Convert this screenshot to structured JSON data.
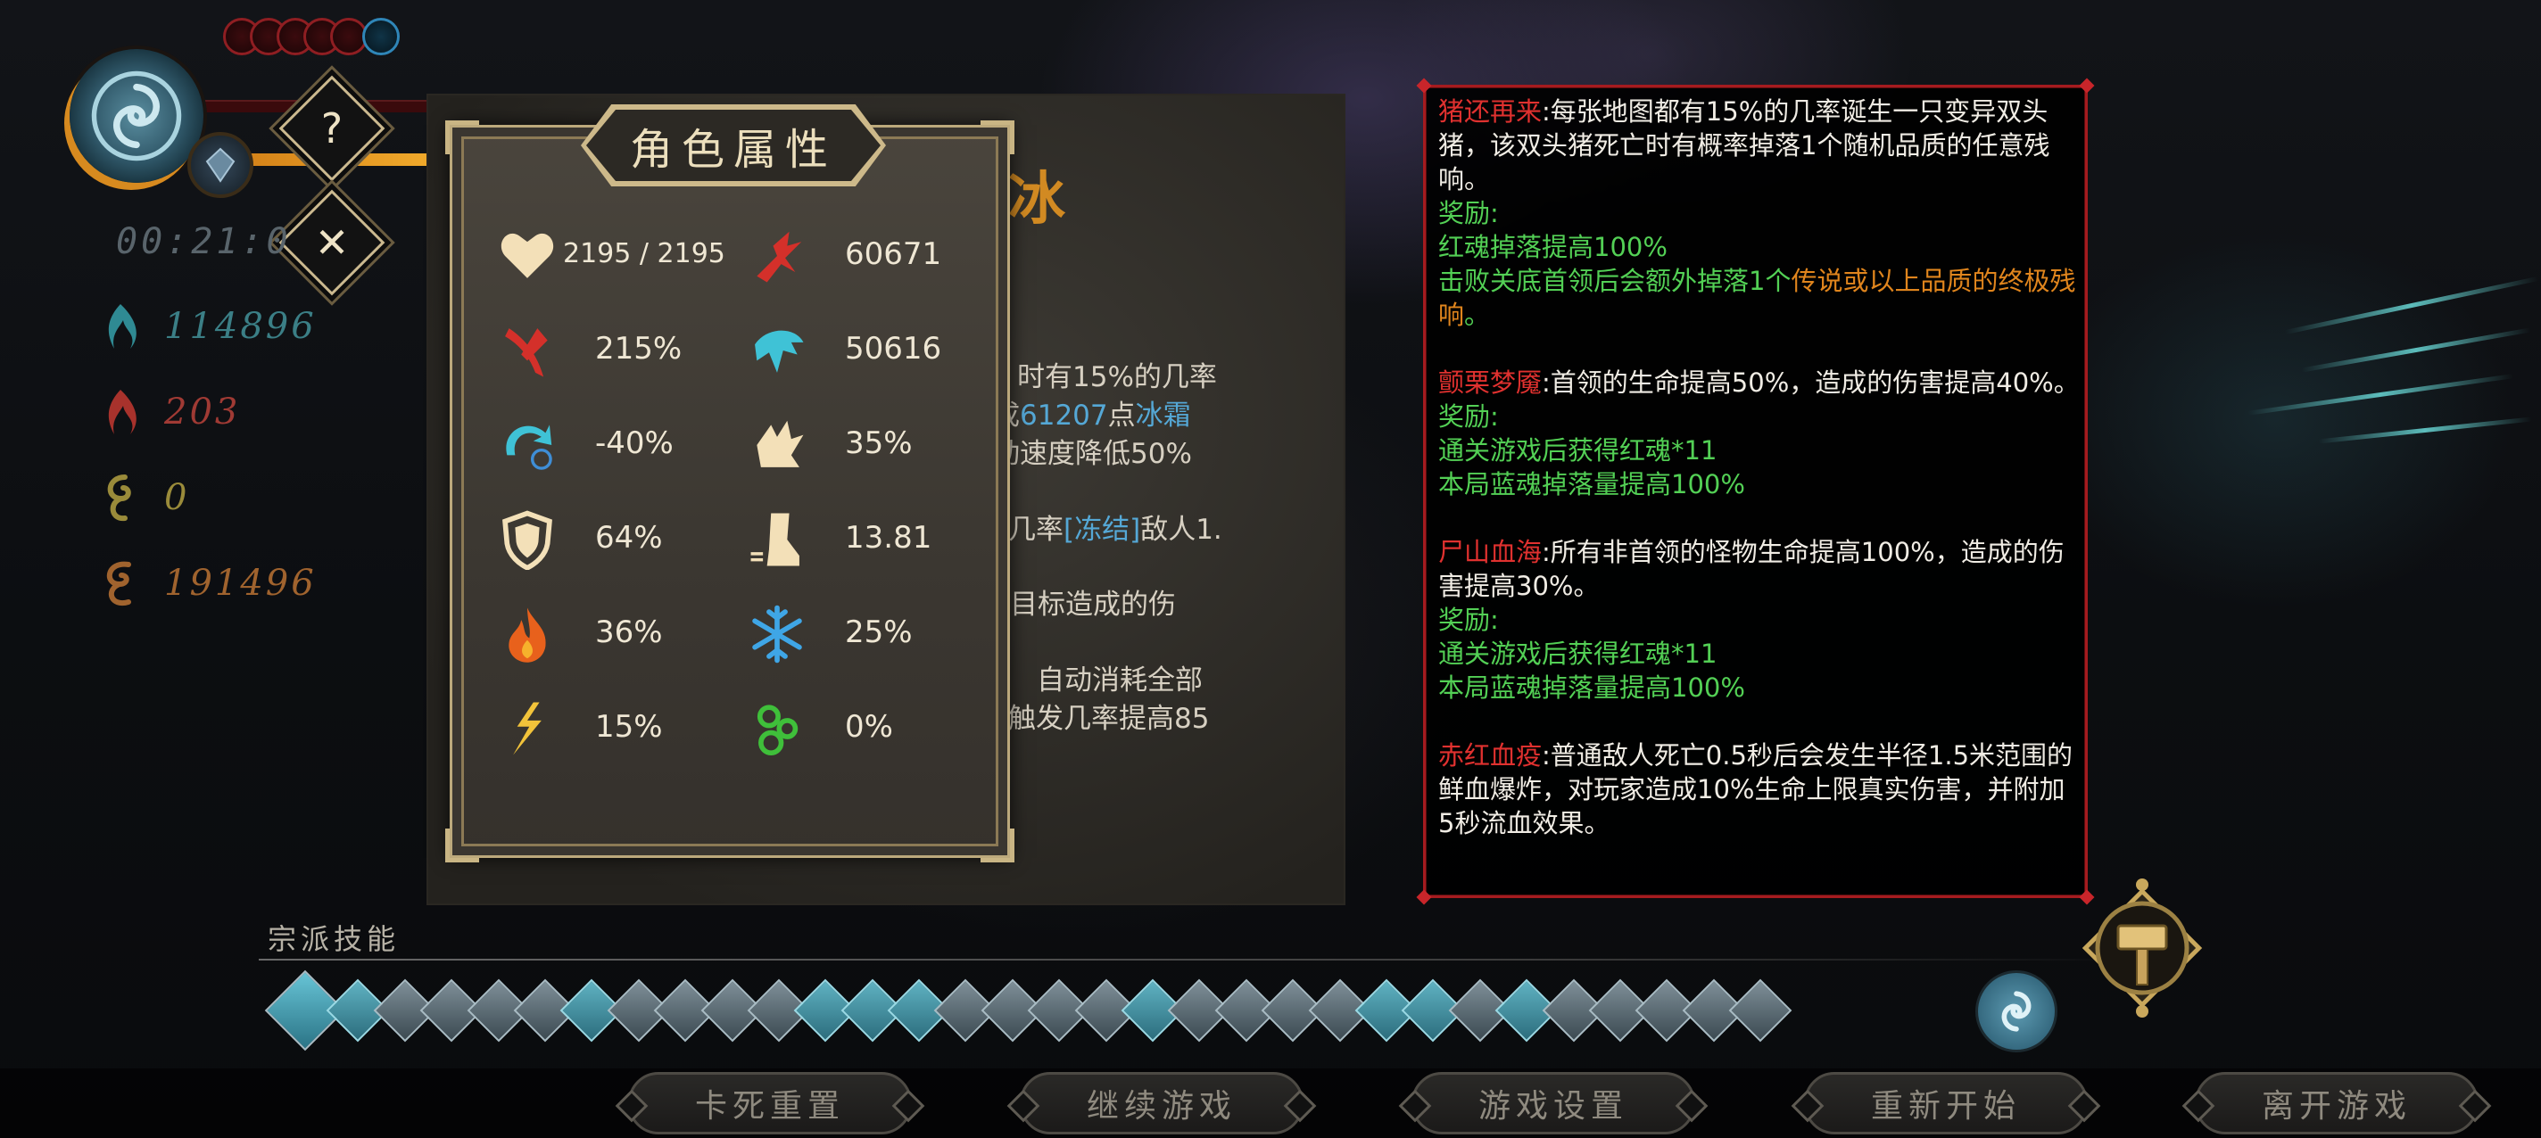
{
  "hud": {
    "timer": "00:21:0",
    "help_label": "?",
    "close_label": "✕",
    "resources": [
      {
        "icon": "blue-soul-icon",
        "value": "114896",
        "color": "#3b7f86"
      },
      {
        "icon": "red-soul-icon",
        "value": "203",
        "color": "#a03a34"
      },
      {
        "icon": "yellow-soul-icon",
        "value": "0",
        "color": "#9a8b3a"
      },
      {
        "icon": "orange-soul-icon",
        "value": "191496",
        "color": "#a0632e"
      }
    ]
  },
  "character": {
    "title": "角色属性",
    "stats": [
      {
        "icon": "heart-icon",
        "value": "2195 / 2195"
      },
      {
        "icon": "attack-claw-icon",
        "value": "60671"
      },
      {
        "icon": "crit-slash-icon",
        "value": "215%"
      },
      {
        "icon": "ice-dragon-icon",
        "value": "50616"
      },
      {
        "icon": "cooldown-icon",
        "value": "-40%"
      },
      {
        "icon": "crit-fist-icon",
        "value": "35%"
      },
      {
        "icon": "shield-icon",
        "value": "64%"
      },
      {
        "icon": "speed-boot-icon",
        "value": "13.81"
      },
      {
        "icon": "fire-icon",
        "value": "36%"
      },
      {
        "icon": "snowflake-icon",
        "value": "25%"
      },
      {
        "icon": "lightning-icon",
        "value": "15%"
      },
      {
        "icon": "poison-icon",
        "value": "0%"
      }
    ]
  },
  "behind_card": {
    "title": "冰",
    "line1": "时有15%的几率",
    "line2_a": "成",
    "line2_b": "61207",
    "line2_c": "点",
    "line2_d": "冰霜",
    "line3": "动速度降低50%",
    "line4_a": "几率",
    "line4_b": "[冻结]",
    "line4_c": "敌人1.",
    "line5": "目标造成的伤",
    "line6": "自动消耗全部",
    "line7": "触发几率提高85"
  },
  "mutators": {
    "m1_name": "猪还再来",
    "m1_desc": ":每张地图都有15%的几率诞生一只变异双头猪，该双头猪死亡时有概率掉落1个随机品质的任意残响。",
    "reward_label": "奖励:",
    "m1_r1": "红魂掉落提高100%",
    "m1_r2_a": "击败关底首领后会额外掉落1个",
    "m1_r2_b": "传说或以上品质的终极残响",
    "m1_r2_c": "。",
    "m2_name": "颤栗梦魇",
    "m2_desc": ":首领的生命提高50%，造成的伤害提高40%。",
    "m2_r1": "通关游戏后获得红魂*11",
    "m2_r2": "本局蓝魂掉落量提高100%",
    "m3_name": "尸山血海",
    "m3_desc": ":所有非首领的怪物生命提高100%，造成的伤害提高30%。",
    "m3_r1": "通关游戏后获得红魂*11",
    "m3_r2": "本局蓝魂掉落量提高100%",
    "m4_name": "赤红血疫",
    "m4_desc": ":普通敌人死亡0.5秒后会发生半径1.5米范围的鲜血爆炸，对玩家造成10%生命上限真实伤害，并附加5秒流血效果。"
  },
  "skills": {
    "label": "宗派技能"
  },
  "menu": {
    "stuck_reset": "卡死重置",
    "continue": "继续游戏",
    "settings": "游戏设置",
    "restart": "重新开始",
    "exit": "离开游戏"
  },
  "colors": {
    "reward_green": "#53d055",
    "mutator_red": "#e0312f",
    "legendary_orange": "#e0851d",
    "panel_border_gold": "#bca97c"
  }
}
